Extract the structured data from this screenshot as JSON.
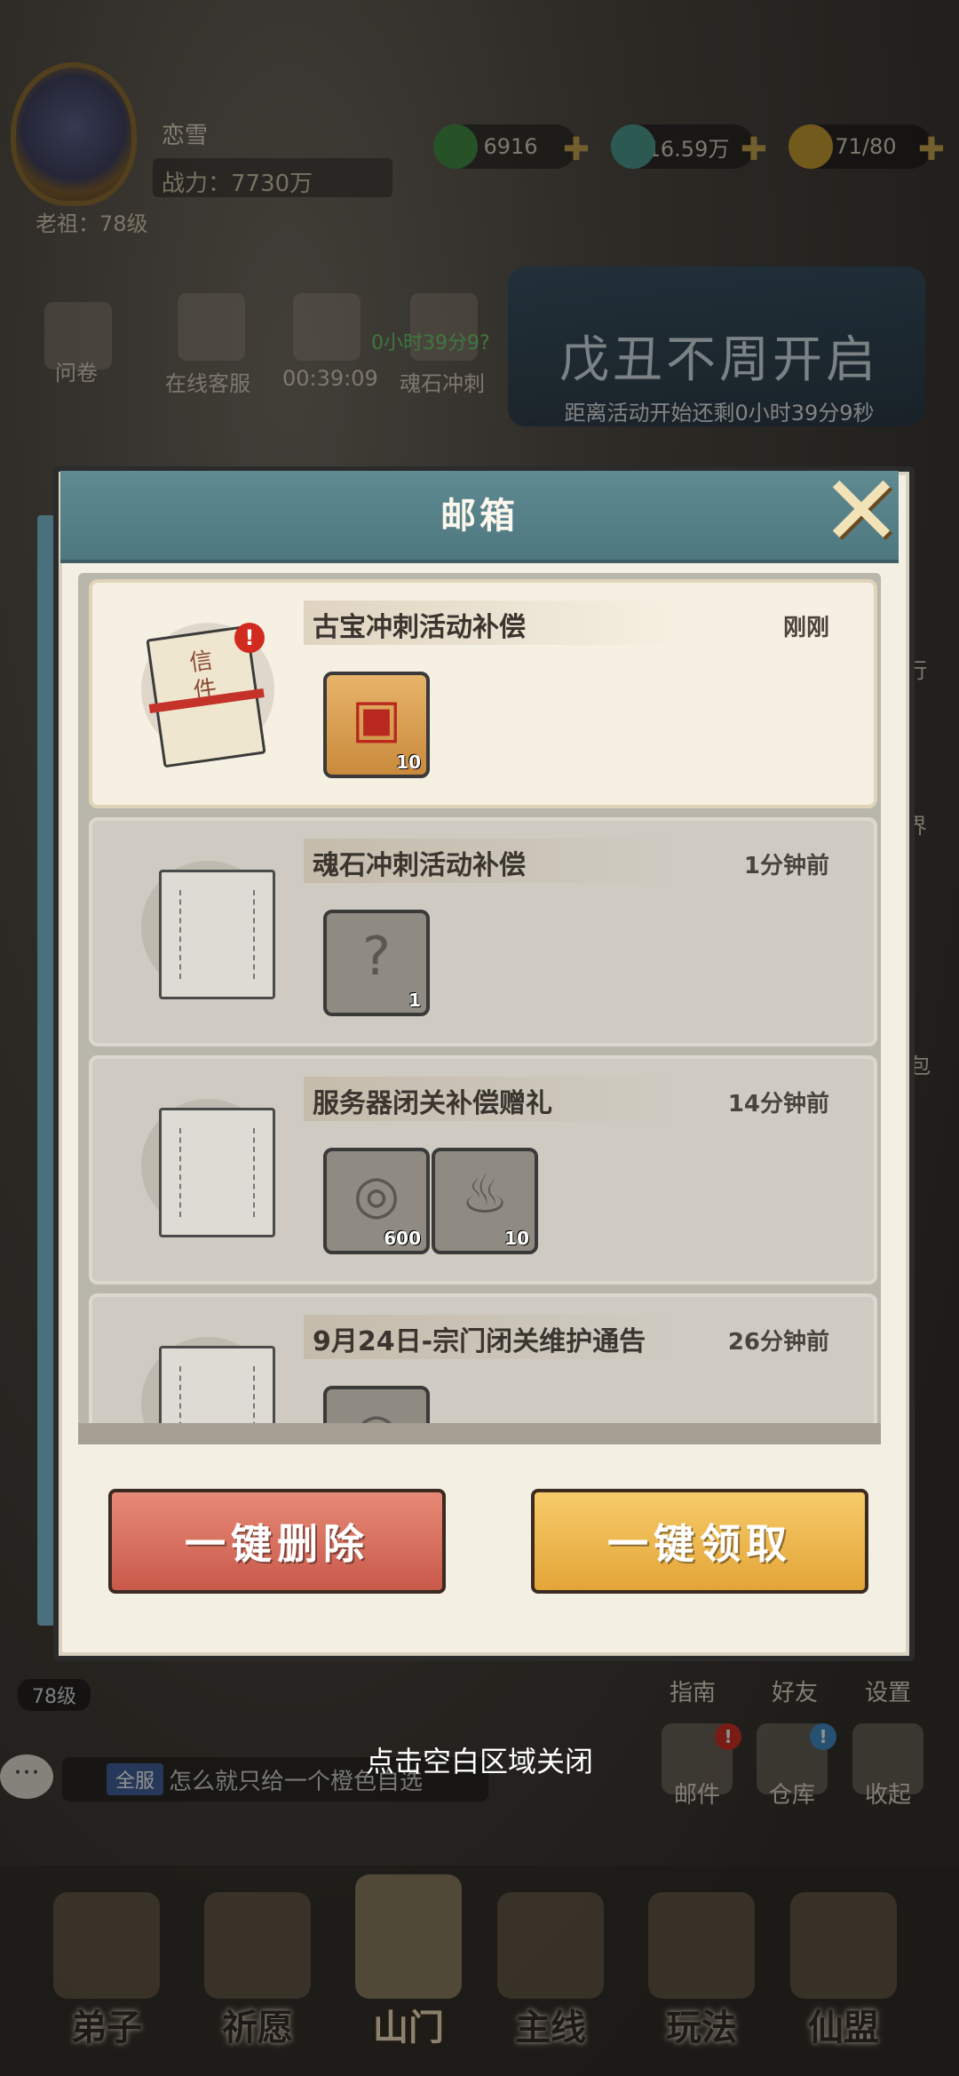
{
  "player": {
    "name": "恋雪",
    "power": "战力：7730万",
    "ancestor": "老祖：78级"
  },
  "resources": [
    {
      "value": "6916",
      "icon": "jade-icon",
      "color": "#3f8a3c"
    },
    {
      "value": "16.59万",
      "icon": "spirit-stone-icon",
      "color": "#4a9a8e"
    },
    {
      "value": "71/80",
      "icon": "stamina-icon",
      "color": "#c69a2a"
    }
  ],
  "side": {
    "survey": "问卷",
    "customer_service": "在线客服",
    "timer": "00:39:09",
    "soul_sprint": "魂石冲刺",
    "soul_timer": "0小时39分9?"
  },
  "event_banner": {
    "title": "戊丑不周开启",
    "subtitle": "距离活动开始还剩0小时39分9秒"
  },
  "mailbox": {
    "title": "邮箱",
    "mails": [
      {
        "subject": "古宝冲刺活动补偿",
        "time": "刚刚",
        "unread": true,
        "envelope_label": "信件",
        "attachments": [
          {
            "icon": "treasure-chest-icon",
            "qty": "10"
          }
        ]
      },
      {
        "subject": "魂石冲刺活动补偿",
        "time": "1分钟前",
        "unread": false,
        "attachments": [
          {
            "icon": "mystery-bag-icon",
            "qty": "1"
          }
        ]
      },
      {
        "subject": "服务器闭关补偿赠礼",
        "time": "14分钟前",
        "unread": false,
        "attachments": [
          {
            "icon": "jade-coin-icon",
            "qty": "600"
          },
          {
            "icon": "spirit-flame-icon",
            "qty": "10"
          }
        ]
      },
      {
        "subject": "9月24日-宗门闭关维护通告",
        "time": "26分钟前",
        "unread": false,
        "attachments": [
          {
            "icon": "jade-coin-icon",
            "qty": ""
          }
        ]
      }
    ],
    "delete_all": "一键删除",
    "claim_all": "一键领取"
  },
  "dismiss_hint": "点击空白区域关闭",
  "right_menu": {
    "guide": "指南",
    "friends": "好友",
    "settings": "设置",
    "mail": "邮件",
    "warehouse": "仓库",
    "collapse": "收起"
  },
  "chat": {
    "channel": "全服",
    "message": "怎么就只给一个橙色自选"
  },
  "level_badge": "78级",
  "side_labels": {
    "xing": "行",
    "jie": "界",
    "bao": "包"
  },
  "nav": [
    {
      "label": "弟子"
    },
    {
      "label": "祈愿"
    },
    {
      "label": "山门"
    },
    {
      "label": "主线"
    },
    {
      "label": "玩法"
    },
    {
      "label": "仙盟"
    }
  ]
}
